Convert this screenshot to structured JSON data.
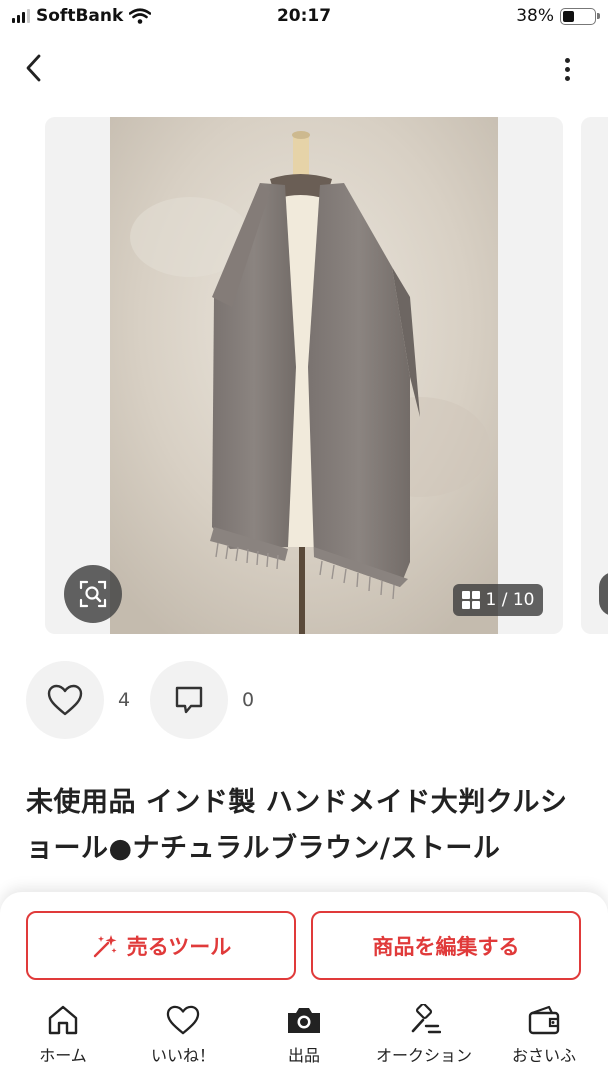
{
  "status_bar": {
    "carrier": "SoftBank",
    "time": "20:17",
    "battery_percent": "38%",
    "battery_level": 0.38
  },
  "nav": {
    "back_icon": "chevron-left-icon",
    "more_icon": "more-vertical-icon"
  },
  "gallery": {
    "counter": "1 / 10",
    "lens_icon": "image-search-icon",
    "grid_icon": "grid-icon"
  },
  "actions": {
    "like_count": "4",
    "comment_count": "0"
  },
  "item": {
    "title": "未使用品 インド製 ハンドメイド大判クルショール●ナチュラルブラウン/ストール"
  },
  "cta": {
    "sell_tool_label": "売るツール",
    "edit_item_label": "商品を編集する"
  },
  "tabbar": {
    "items": [
      {
        "label": "ホーム",
        "icon": "home-icon"
      },
      {
        "label": "いいね！",
        "icon": "heart-icon"
      },
      {
        "label": "出品",
        "icon": "camera-icon"
      },
      {
        "label": "オークション",
        "icon": "auction-gavel-icon"
      },
      {
        "label": "おさいふ",
        "icon": "wallet-icon"
      }
    ]
  },
  "colors": {
    "accent": "#e03a3a",
    "text": "#222222",
    "surface": "#f2f2f2"
  }
}
